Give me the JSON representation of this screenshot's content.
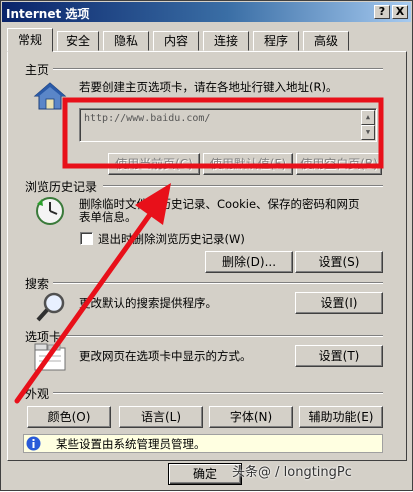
{
  "window": {
    "title": "Internet 选项",
    "help_glyph": "?",
    "close_glyph": "X"
  },
  "tabs": [
    {
      "label": "常规"
    },
    {
      "label": "安全"
    },
    {
      "label": "隐私"
    },
    {
      "label": "内容"
    },
    {
      "label": "连接"
    },
    {
      "label": "程序"
    },
    {
      "label": "高级"
    }
  ],
  "home": {
    "title": "主页",
    "description": "若要创建主页选项卡，请在各地址行键入地址(R)。",
    "address_value": "http://www.baidu.com/",
    "btn_current": "使用当前页(C)",
    "btn_default": "使用默认值(F)",
    "btn_blank": "使用空白页(B)",
    "icon": "home-icon"
  },
  "history": {
    "title": "浏览历史记录",
    "description_line1": "删除临时文件、历史记录、Cookie、保存的密码和网页",
    "description_line2": "表单信息。",
    "checkbox_label": "退出时删除浏览历史记录(W)",
    "btn_delete": "删除(D)...",
    "btn_settings": "设置(S)",
    "icon": "history-clock-icon"
  },
  "search": {
    "title": "搜索",
    "description": "更改默认的搜索提供程序。",
    "btn_settings": "设置(I)",
    "icon": "magnifier-icon"
  },
  "tabs_section": {
    "title": "选项卡",
    "description": "更改网页在选项卡中显示的方式。",
    "btn_settings": "设置(T)",
    "icon": "tabs-icon"
  },
  "appearance": {
    "title": "外观",
    "btn_colors": "颜色(O)",
    "btn_languages": "语言(L)",
    "btn_fonts": "字体(N)",
    "btn_accessibility": "辅助功能(E)"
  },
  "info": {
    "text": "某些设置由系统管理员管理。",
    "icon": "info-icon"
  },
  "footer": {
    "ok_label": "确定",
    "watermark": "头条@ / longtingPc"
  },
  "annotation_color": "#e8101a"
}
